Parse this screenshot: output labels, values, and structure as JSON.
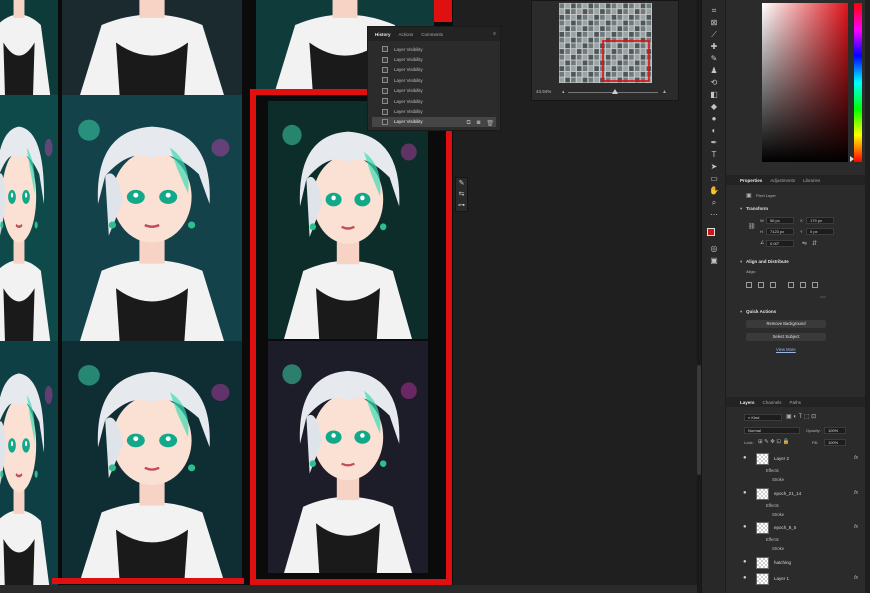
{
  "history": {
    "tabs": [
      "History",
      "Actions",
      "Comments"
    ],
    "items": [
      "Layer Visibility",
      "Layer Visibility",
      "Layer Visibility",
      "Layer Visibility",
      "Layer Visibility",
      "Layer Visibility",
      "Layer Visibility",
      "Layer Visibility"
    ],
    "selected_index": 7
  },
  "navigator": {
    "zoom": "43.94%"
  },
  "properties": {
    "tabs": [
      "Properties",
      "Adjustments",
      "Libraries"
    ],
    "layer_kind": "Pixel Layer",
    "transform": {
      "title": "Transform",
      "w_label": "W",
      "w_value": "56 px",
      "h_label": "H",
      "h_value": "7123 px",
      "x_label": "X",
      "x_value": "179 px",
      "y_label": "Y",
      "y_value": "0 px",
      "angle_value": "0.00°"
    },
    "align": {
      "title": "Align and Distribute",
      "sublabel": "Align:"
    },
    "quick_actions": {
      "title": "Quick Actions",
      "remove_background": "Remove Background",
      "select_subject": "Select Subject",
      "view_more": "View More"
    }
  },
  "layers": {
    "tabs": [
      "Layers",
      "Channels",
      "Paths"
    ],
    "kind_filter": "Kind",
    "blend_mode": "Normal",
    "opacity_label": "Opacity:",
    "opacity_value": "100%",
    "lock_label": "Lock:",
    "fill_label": "Fill:",
    "fill_value": "100%",
    "items": [
      {
        "name": "Layer 2",
        "effects": [
          "Effects",
          "Stroke"
        ]
      },
      {
        "name": "epoch_21_14",
        "effects": [
          "Effects",
          "Stroke"
        ]
      },
      {
        "name": "epoch_8_5",
        "effects": [
          "Effects",
          "Stroke"
        ]
      },
      {
        "name": "hatching",
        "effects": []
      },
      {
        "name": "Layer 1",
        "effects": []
      }
    ],
    "fx_symbol": "fx"
  },
  "colors": {
    "accent_red": "#e01010",
    "foreground": "#d21414",
    "background": "#ffffff",
    "panel": "#2b2b2b",
    "workspace": "#1f1f1f"
  }
}
